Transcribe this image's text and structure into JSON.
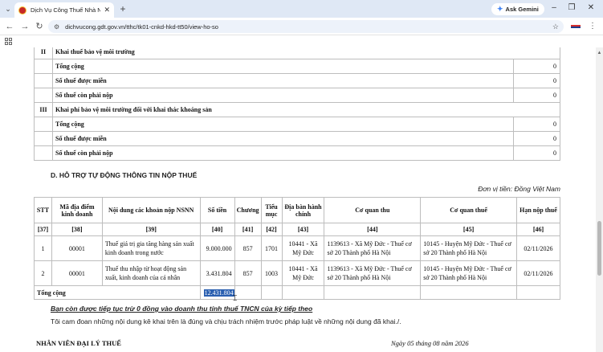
{
  "browser": {
    "tab_title": "Dịch Vụ Công Thuế Nhà Nước",
    "new_tab": "+",
    "ask_gemini": "Ask Gemini",
    "url": "dichvucong.gdt.gov.vn/tthc/tk01-cnkd-hkd-tt50/view-ho-so"
  },
  "env_table": {
    "sections": [
      {
        "roman": "II",
        "title": "Khai thuế bảo vệ môi trường",
        "rows": [
          {
            "label": "Tổng cộng",
            "value": "0"
          },
          {
            "label": "Số thuế được miễn",
            "value": "0"
          },
          {
            "label": "Số thuế còn phải nộp",
            "value": "0"
          }
        ]
      },
      {
        "roman": "III",
        "title": "Khai phí bảo vệ môi trường đối với khai thác khoáng sản",
        "rows": [
          {
            "label": "Tổng cộng",
            "value": "0"
          },
          {
            "label": "Số thuế được miễn",
            "value": "0"
          },
          {
            "label": "Số thuế còn phải nộp",
            "value": "0"
          }
        ]
      }
    ]
  },
  "section_d": {
    "title": "D. HỖ TRỢ TỰ ĐỘNG THÔNG TIN NỘP THUẾ",
    "unit": "Đơn vị tiền: Đồng Việt Nam",
    "headers": [
      "STT",
      "Mã địa điểm kinh doanh",
      "Nội dung các khoản nộp NSNN",
      "Số tiền",
      "Chương",
      "Tiểu mục",
      "Địa bàn hành chính",
      "Cơ quan thu",
      "Cơ quan thuế",
      "Hạn nộp thuế"
    ],
    "codes": [
      "[37]",
      "[38]",
      "[39]",
      "[40]",
      "[41]",
      "[42]",
      "[43]",
      "[44]",
      "[45]",
      "[46]"
    ],
    "rows": [
      {
        "stt": "1",
        "location": "00001",
        "content": "Thuế giá trị gia tăng hàng sản xuất kinh doanh trong nước",
        "amount": "9.000.000",
        "chapter": "857",
        "subitem": "1701",
        "area": "10441 - Xã Mỹ Đức",
        "collector": "1139613 - Xã Mỹ Đức - Thuế cơ sở 20 Thành phố Hà Nội",
        "tax_office": "10145 - Huyện Mỹ Đức - Thuế cơ sở 20 Thành phố Hà Nội",
        "deadline": "02/11/2026"
      },
      {
        "stt": "2",
        "location": "00001",
        "content": "Thuế thu nhập từ hoạt động sản xuất, kinh doanh của cá nhân",
        "amount": "3.431.804",
        "chapter": "857",
        "subitem": "1003",
        "area": "10441 - Xã Mỹ Đức",
        "collector": "1139613 - Xã Mỹ Đức - Thuế cơ sở 20 Thành phố Hà Nội",
        "tax_office": "10145 - Huyện Mỹ Đức - Thuế cơ sở 20 Thành phố Hà Nội",
        "deadline": "02/11/2026"
      }
    ],
    "total_label": "Tổng cộng",
    "total_amount": "12.431.804"
  },
  "notes": {
    "carry_over": "Bạn còn được tiếp tục trừ 0 đồng vào doanh thu tính thuế TNCN của kỳ tiếp theo",
    "commitment": "Tôi cam đoan những nội dung kê khai trên là đúng và chịu trách nhiệm trước pháp luật về những nội dung đã khai./."
  },
  "footer": {
    "staff": "NHÂN VIÊN ĐẠI LÝ THUẾ",
    "date": "Ngày 05 tháng 08 năm 2026"
  },
  "colors": {
    "selection": "#2a5fb0",
    "tab_strip": "#dfe8f5"
  }
}
